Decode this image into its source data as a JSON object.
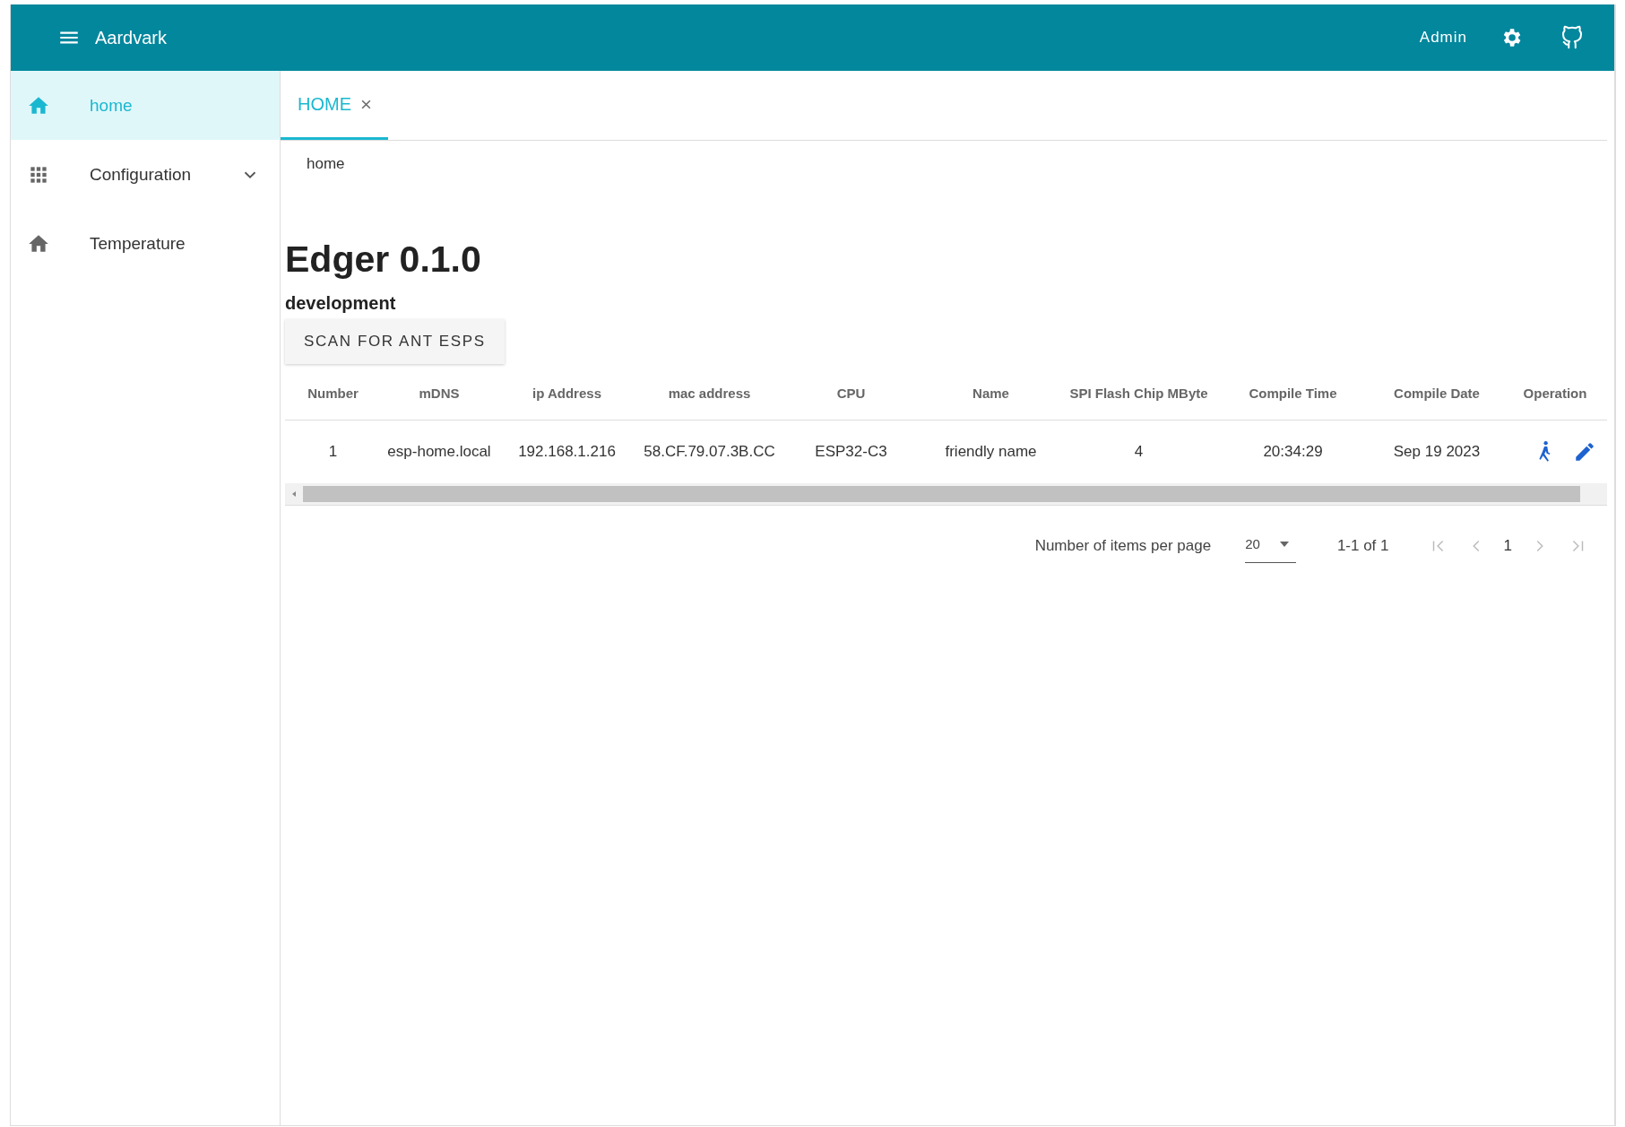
{
  "header": {
    "title": "Aardvark",
    "user": "Admin"
  },
  "sidebar": {
    "items": [
      {
        "label": "home",
        "kind": "home",
        "selected": true
      },
      {
        "label": "Configuration",
        "kind": "apps",
        "selected": false,
        "expanded": false
      },
      {
        "label": "Temperature",
        "kind": "home",
        "selected": false
      }
    ]
  },
  "tabs": [
    {
      "label": "HOME",
      "selected": true
    }
  ],
  "breadcrumb": "home",
  "title": "Edger 0.1.0",
  "subtitle": "development",
  "scan_button": "SCAN FOR ANT ESPS",
  "table": {
    "columns": [
      "Number",
      "mDNS",
      "ip Address",
      "mac address",
      "CPU",
      "Name",
      "SPI Flash Chip MByte",
      "Compile Time",
      "Compile Date",
      "Operation"
    ],
    "rows": [
      {
        "cells": [
          "1",
          "esp-home.local",
          "192.168.1.216",
          "58.CF.79.07.3B.CC",
          "ESP32-C3",
          "friendly name",
          "4",
          "20:34:29",
          "Sep 19 2023"
        ]
      }
    ]
  },
  "pagination": {
    "label": "Number of items per page",
    "per_page": "20",
    "range": "1-1 of 1",
    "page": "1"
  }
}
